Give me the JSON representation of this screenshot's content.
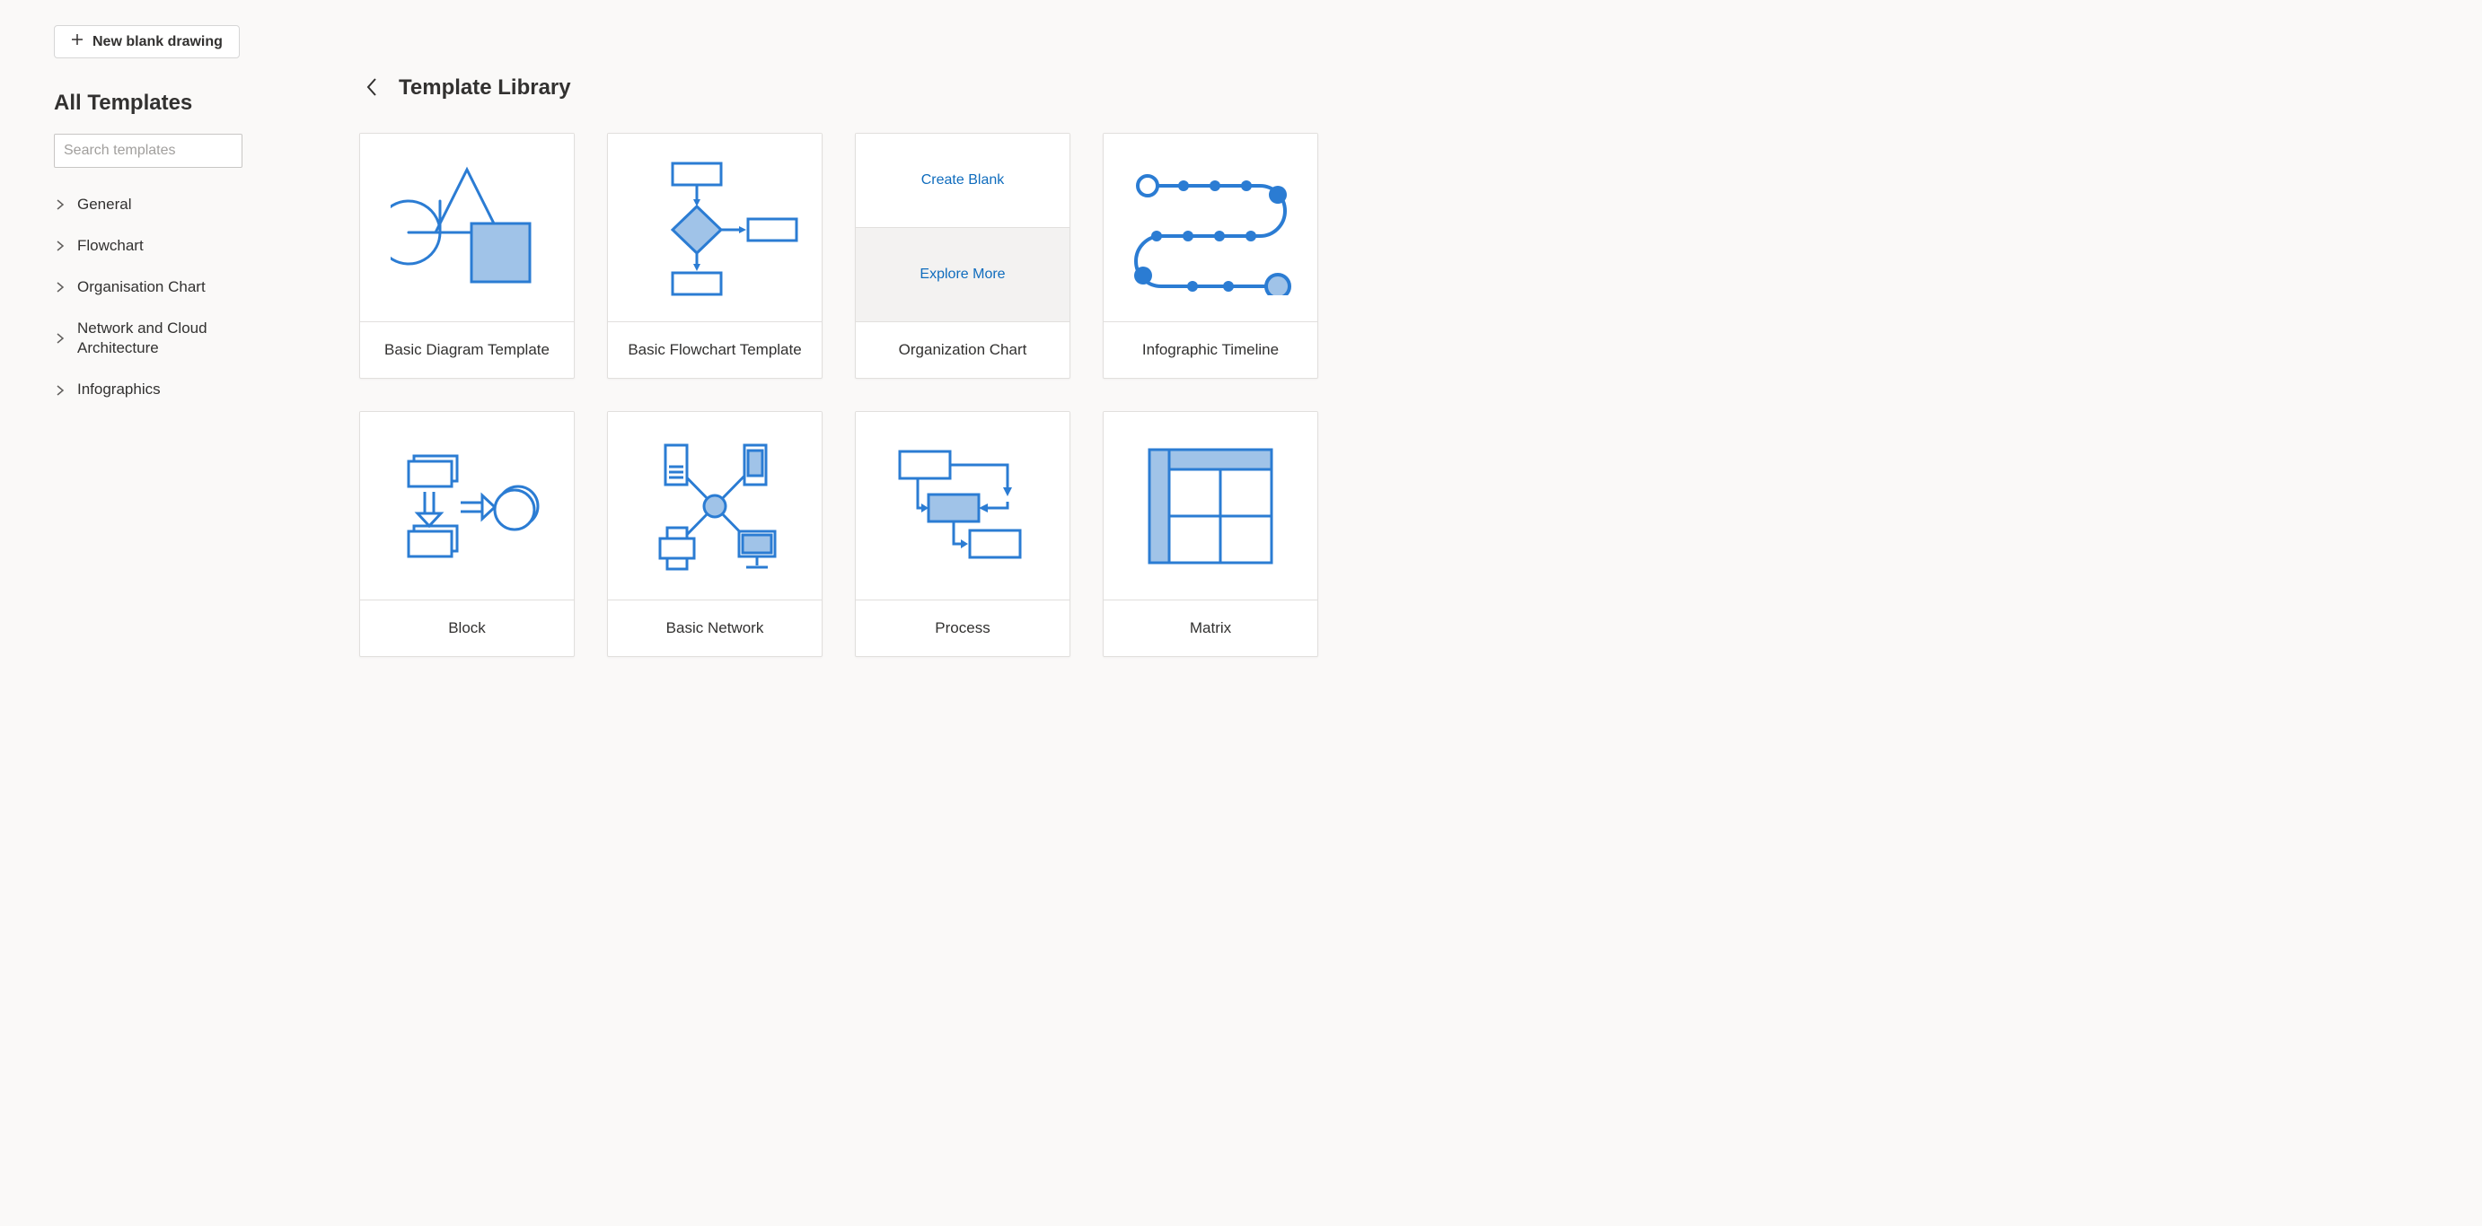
{
  "sidebar": {
    "new_blank_label": "New blank drawing",
    "title": "All Templates",
    "search_placeholder": "Search templates",
    "categories": [
      {
        "label": "General"
      },
      {
        "label": "Flowchart"
      },
      {
        "label": "Organisation Chart"
      },
      {
        "label": "Network and Cloud Architecture"
      },
      {
        "label": "Infographics"
      }
    ]
  },
  "main": {
    "title": "Template Library",
    "templates": [
      {
        "label": "Basic Diagram Template",
        "preview": "basic-diagram"
      },
      {
        "label": "Basic Flowchart Template",
        "preview": "basic-flowchart"
      },
      {
        "label": "Organization Chart",
        "preview": "organization-chart",
        "create_blank_label": "Create Blank",
        "explore_more_label": "Explore More"
      },
      {
        "label": "Infographic Timeline",
        "preview": "infographic-timeline"
      },
      {
        "label": "Block",
        "preview": "block"
      },
      {
        "label": "Basic Network",
        "preview": "basic-network"
      },
      {
        "label": "Process",
        "preview": "process"
      },
      {
        "label": "Matrix",
        "preview": "matrix"
      }
    ]
  },
  "colors": {
    "stroke": "#2b7cd3",
    "fill": "#a0c3e8",
    "accent": "#0f6cbd"
  }
}
